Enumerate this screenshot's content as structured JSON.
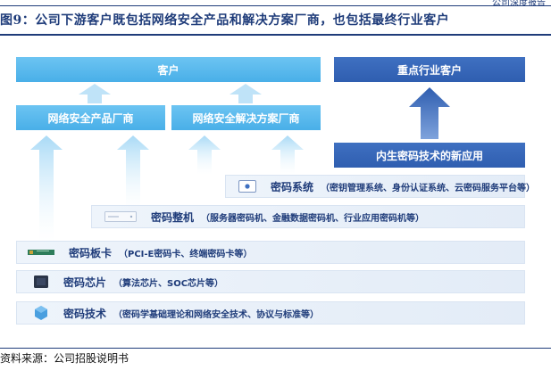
{
  "header": {
    "tag": "公司深度报告"
  },
  "figure": {
    "title": "图9：公司下游客户既包括网络安全产品和解决方案厂商，也包括最终行业客户",
    "source": "资料来源：公司招股说明书"
  },
  "diagram": {
    "customers": "客户",
    "key_customers": "重点行业客户",
    "product_vendors": "网络安全产品厂商",
    "solution_vendors": "网络安全解决方案厂商",
    "endogenous_apps": "内生密码技术的新应用",
    "layers": [
      {
        "name": "密码系统",
        "desc": "（密钥管理系统、身份认证系统、云密码服务平台等）",
        "icon": "screen-icon"
      },
      {
        "name": "密码整机",
        "desc": "（服务器密码机、金融数据密码机、行业应用密码机等）",
        "icon": "server-icon"
      },
      {
        "name": "密码板卡",
        "desc": "（PCI-E密码卡、终端密码卡等）",
        "icon": "card-icon"
      },
      {
        "name": "密码芯片",
        "desc": "（算法芯片、SOC芯片等）",
        "icon": "chip-icon"
      },
      {
        "name": "密码技术",
        "desc": "（密码学基础理论和网络安全技术、协议与标准等）",
        "icon": "hexagon-icon"
      }
    ]
  },
  "colors": {
    "light_blue": "#49afe8",
    "dark_blue": "#2f5eb0",
    "title_blue": "#1f3c7a",
    "layer_bg": "#e8f0f9"
  }
}
